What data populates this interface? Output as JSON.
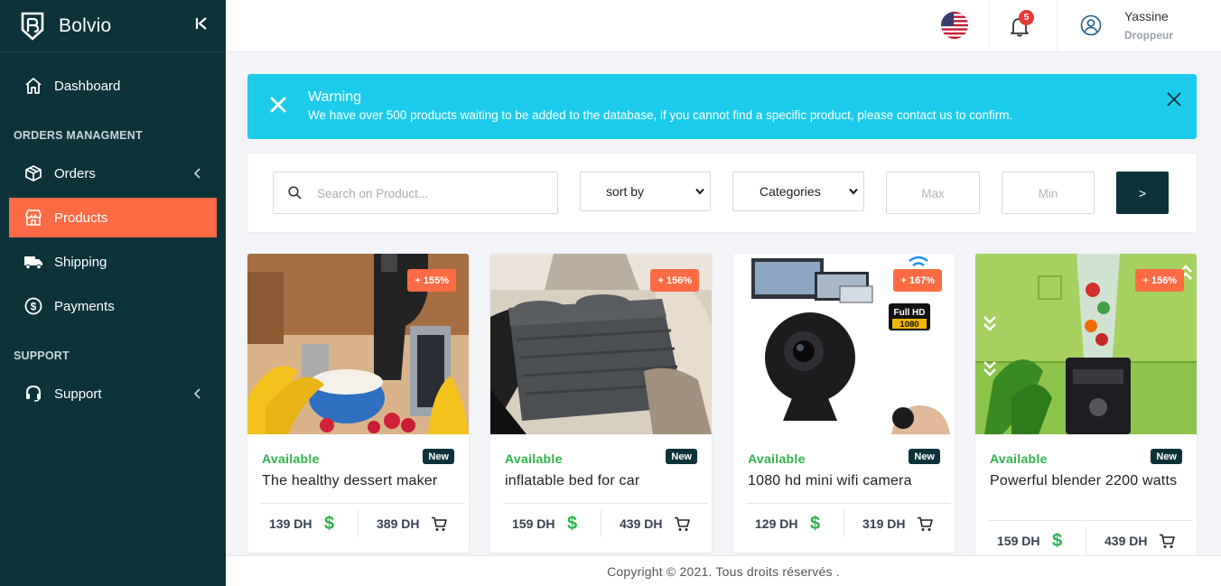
{
  "app": {
    "name": "Bolvio"
  },
  "sidebar": {
    "dashboard": "Dashboard",
    "section_orders": "ORDERS MANAGMENT",
    "orders": "Orders",
    "products": "Products",
    "shipping": "Shipping",
    "payments": "Payments",
    "section_support": "SUPPORT",
    "support": "Support"
  },
  "header": {
    "notifications_count": "5",
    "user_name": "Yassine",
    "user_role": "Droppeur"
  },
  "alert": {
    "title": "Warning",
    "message": "We have over 500 products waiting to be added to the database, if you cannot find a specific product, please contact us to confirm."
  },
  "filter": {
    "search_placeholder": "Search on Product...",
    "sort_label": "sort by",
    "categories_label": "Categories",
    "max_placeholder": "Max",
    "min_placeholder": "Min",
    "go_label": ">"
  },
  "products": [
    {
      "badge": "+ 155%",
      "status": "Available",
      "tag": "New",
      "title": "The healthy dessert maker",
      "buy_price": "139 DH",
      "sell_price": "389 DH"
    },
    {
      "badge": "+ 156%",
      "status": "Available",
      "tag": "New",
      "title": "inflatable bed for car",
      "buy_price": "159 DH",
      "sell_price": "439 DH"
    },
    {
      "badge": "+ 167%",
      "status": "Available",
      "tag": "New",
      "title": "1080 hd mini wifi camera",
      "buy_price": "129 DH",
      "sell_price": "319 DH"
    },
    {
      "badge": "+ 156%",
      "status": "Available",
      "tag": "New",
      "title": "Powerful blender 2200 watts",
      "buy_price": "159 DH",
      "sell_price": "439 DH"
    }
  ],
  "camera_image_text": "Full HD 1080",
  "currency_symbol": "$",
  "footer": {
    "text": "Copyright © 2021. Tous droits réservés ."
  },
  "colors": {
    "sidebar": "#0c333a",
    "accent": "#fd6b45",
    "alert": "#1ccbeb",
    "available": "#2db24a"
  }
}
